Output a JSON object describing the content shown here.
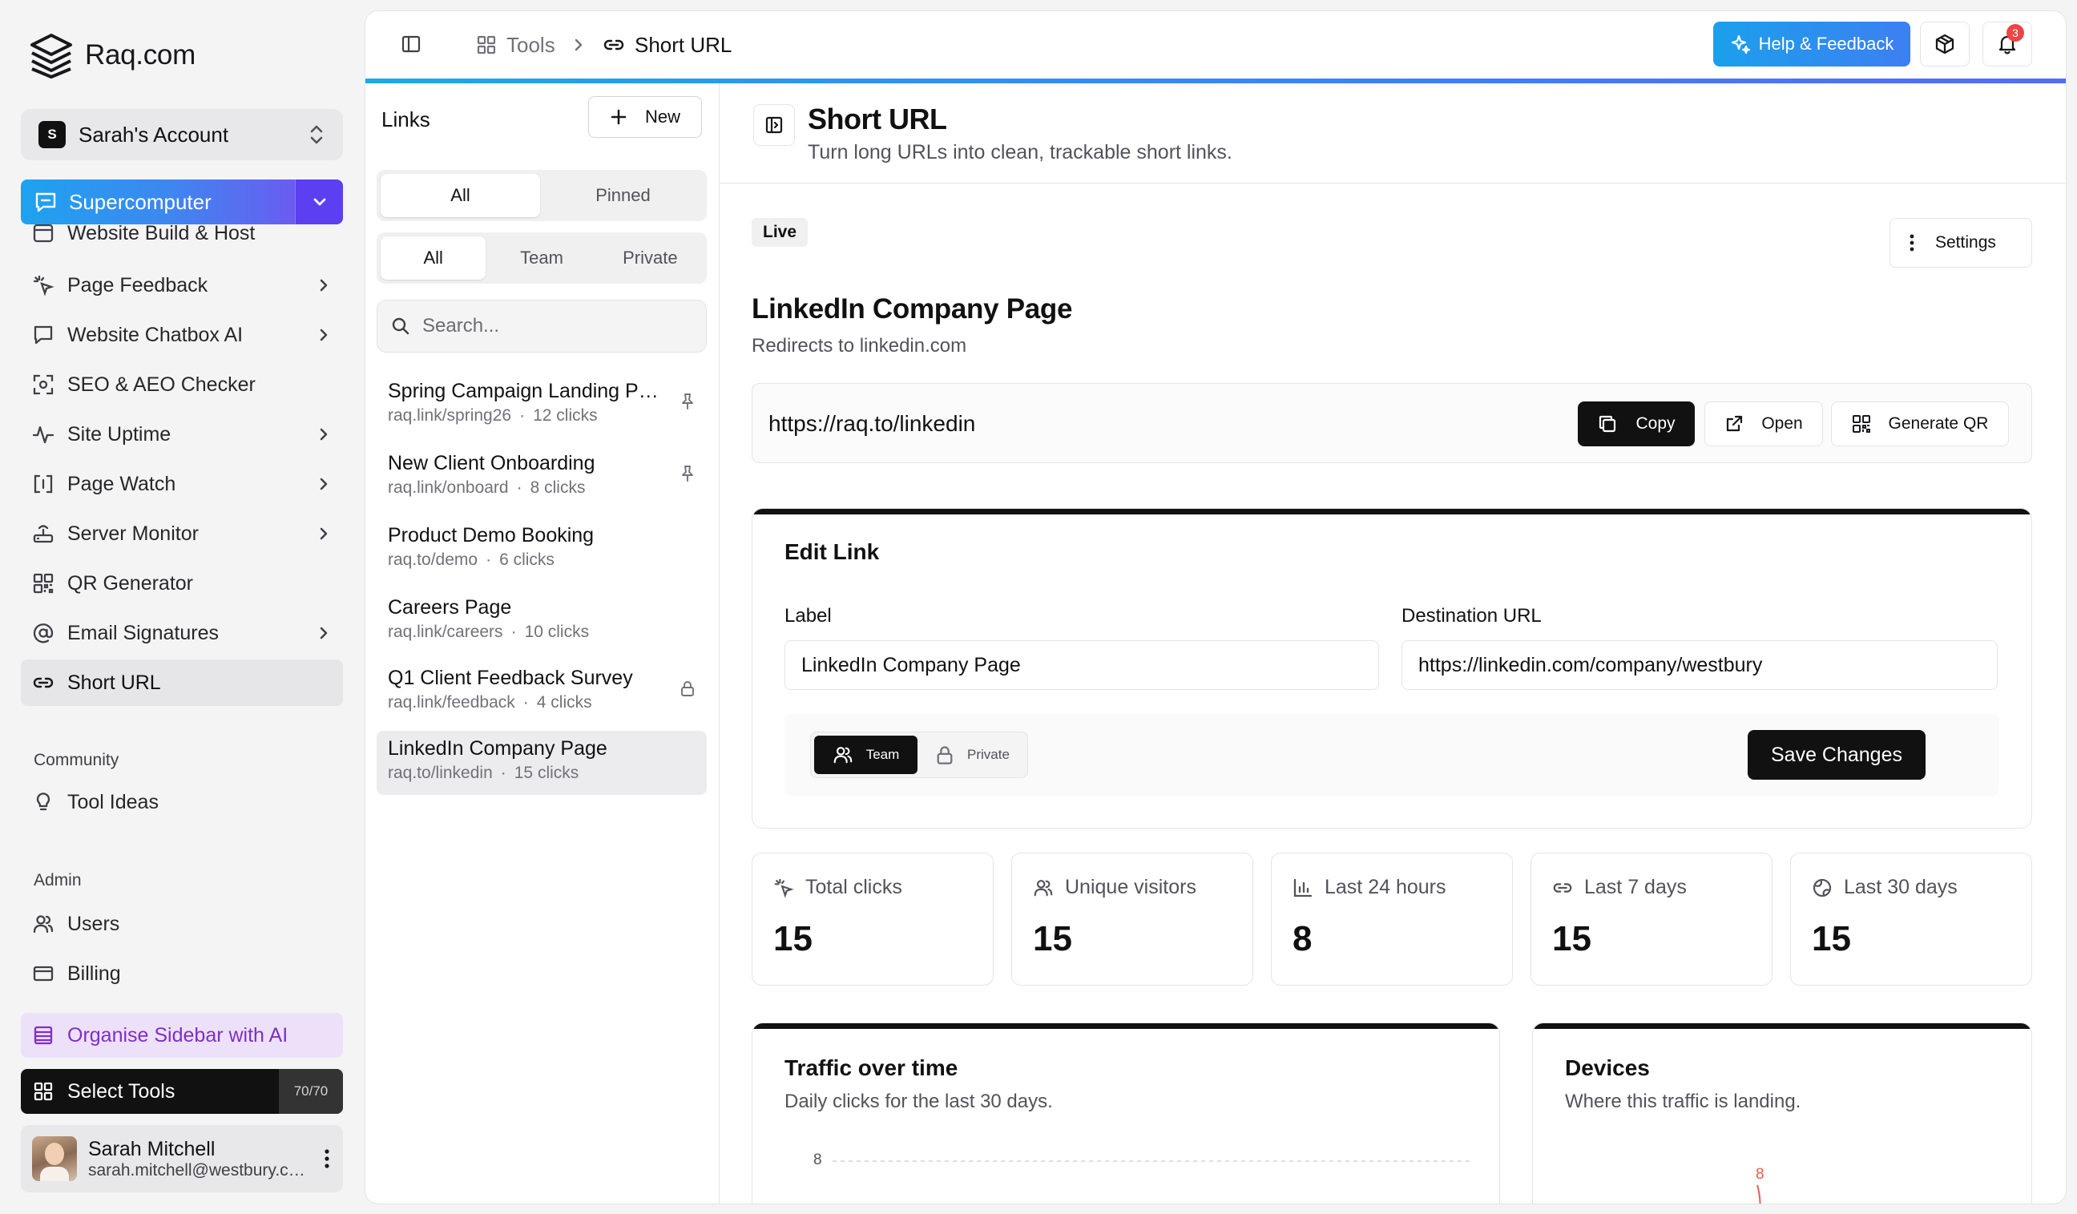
{
  "brand": {
    "name": "Raq.com"
  },
  "account": {
    "badge": "S",
    "name": "Sarah's Account"
  },
  "supercomputer": {
    "label": "Supercomputer"
  },
  "sidebar": {
    "cut_item": "Website Build & Host",
    "items": [
      {
        "label": "Page Feedback",
        "icon": "sparkle-click-icon",
        "chevron": true
      },
      {
        "label": "Website Chatbox AI",
        "icon": "chat-icon",
        "chevron": true
      },
      {
        "label": "SEO & AEO Checker",
        "icon": "scan-icon",
        "chevron": false
      },
      {
        "label": "Site Uptime",
        "icon": "pulse-icon",
        "chevron": true
      },
      {
        "label": "Page Watch",
        "icon": "bracket-icon",
        "chevron": true
      },
      {
        "label": "Server Monitor",
        "icon": "router-icon",
        "chevron": true
      },
      {
        "label": "QR Generator",
        "icon": "qr-icon",
        "chevron": false
      },
      {
        "label": "Email Signatures",
        "icon": "at-icon",
        "chevron": true
      },
      {
        "label": "Short URL",
        "icon": "link-icon",
        "chevron": false,
        "active": true
      }
    ],
    "community_label": "Community",
    "community_items": [
      {
        "label": "Tool Ideas"
      }
    ],
    "admin_label": "Admin",
    "admin_items": [
      {
        "label": "Users"
      },
      {
        "label": "Billing"
      }
    ],
    "organise_label": "Organise Sidebar with AI",
    "select_tools_label": "Select Tools",
    "select_tools_count": "70/70"
  },
  "user": {
    "name": "Sarah Mitchell",
    "email": "sarah.mitchell@westbury.com"
  },
  "breadcrumb": {
    "tools": "Tools",
    "current": "Short URL"
  },
  "header": {
    "help_label": "Help & Feedback",
    "notification_count": "3"
  },
  "links_panel": {
    "title": "Links",
    "new_label": "New",
    "filter_tabs": [
      "All",
      "Pinned"
    ],
    "scope_tabs": [
      "All",
      "Team",
      "Private"
    ],
    "search_placeholder": "Search...",
    "items": [
      {
        "title": "Spring Campaign Landing Page",
        "url": "raq.link/spring26",
        "clicks": "12 clicks",
        "status": "pinned"
      },
      {
        "title": "New Client Onboarding",
        "url": "raq.link/onboard",
        "clicks": "8 clicks",
        "status": "pinned"
      },
      {
        "title": "Product Demo Booking",
        "url": "raq.to/demo",
        "clicks": "6 clicks",
        "status": ""
      },
      {
        "title": "Careers Page",
        "url": "raq.link/careers",
        "clicks": "10 clicks",
        "status": ""
      },
      {
        "title": "Q1 Client Feedback Survey",
        "url": "raq.link/feedback",
        "clicks": "4 clicks",
        "status": "private"
      },
      {
        "title": "LinkedIn Company Page",
        "url": "raq.to/linkedin",
        "clicks": "15 clicks",
        "status": "selected"
      }
    ]
  },
  "detail": {
    "title": "Short URL",
    "subtitle": "Turn long URLs into clean, trackable short links.",
    "status": "Live",
    "settings_label": "Settings",
    "link_title": "LinkedIn Company Page",
    "link_sub": "Redirects to linkedin.com",
    "short_url": "https://raq.to/linkedin",
    "copy_label": "Copy",
    "open_label": "Open",
    "qr_label": "Generate QR"
  },
  "edit": {
    "title": "Edit Link",
    "label_label": "Label",
    "label_value": "LinkedIn Company Page",
    "dest_label": "Destination URL",
    "dest_value": "https://linkedin.com/company/westbury",
    "visibility_options": [
      "Team",
      "Private"
    ],
    "visibility_selected": "Team",
    "save_label": "Save Changes"
  },
  "stats": [
    {
      "label": "Total clicks",
      "value": "15",
      "icon": "sparkle-click-icon"
    },
    {
      "label": "Unique visitors",
      "value": "15",
      "icon": "users-icon"
    },
    {
      "label": "Last 24 hours",
      "value": "8",
      "icon": "bar-chart-icon"
    },
    {
      "label": "Last 7 days",
      "value": "15",
      "icon": "link-icon"
    },
    {
      "label": "Last 30 days",
      "value": "15",
      "icon": "globe-icon"
    }
  ],
  "traffic": {
    "title": "Traffic over time",
    "subtitle": "Daily clicks for the last 30 days.",
    "ytick_top": "8"
  },
  "devices": {
    "title": "Devices",
    "subtitle": "Where this traffic is landing.",
    "peak_label": "8"
  },
  "colors": {
    "accent": "#1da3ef",
    "violet": "#5b3ff0",
    "purple_text": "#7e2fc9",
    "dark": "#111111",
    "alert": "#ef4444",
    "device_line": "#e0624a"
  }
}
